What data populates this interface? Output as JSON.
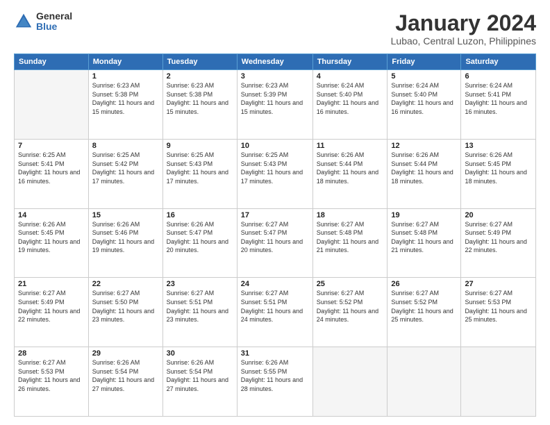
{
  "header": {
    "logo_general": "General",
    "logo_blue": "Blue",
    "month_title": "January 2024",
    "location": "Lubao, Central Luzon, Philippines"
  },
  "days_of_week": [
    "Sunday",
    "Monday",
    "Tuesday",
    "Wednesday",
    "Thursday",
    "Friday",
    "Saturday"
  ],
  "weeks": [
    [
      {
        "day": "",
        "sunrise": "",
        "sunset": "",
        "daylight": ""
      },
      {
        "day": "1",
        "sunrise": "Sunrise: 6:23 AM",
        "sunset": "Sunset: 5:38 PM",
        "daylight": "Daylight: 11 hours and 15 minutes."
      },
      {
        "day": "2",
        "sunrise": "Sunrise: 6:23 AM",
        "sunset": "Sunset: 5:38 PM",
        "daylight": "Daylight: 11 hours and 15 minutes."
      },
      {
        "day": "3",
        "sunrise": "Sunrise: 6:23 AM",
        "sunset": "Sunset: 5:39 PM",
        "daylight": "Daylight: 11 hours and 15 minutes."
      },
      {
        "day": "4",
        "sunrise": "Sunrise: 6:24 AM",
        "sunset": "Sunset: 5:40 PM",
        "daylight": "Daylight: 11 hours and 16 minutes."
      },
      {
        "day": "5",
        "sunrise": "Sunrise: 6:24 AM",
        "sunset": "Sunset: 5:40 PM",
        "daylight": "Daylight: 11 hours and 16 minutes."
      },
      {
        "day": "6",
        "sunrise": "Sunrise: 6:24 AM",
        "sunset": "Sunset: 5:41 PM",
        "daylight": "Daylight: 11 hours and 16 minutes."
      }
    ],
    [
      {
        "day": "7",
        "sunrise": "Sunrise: 6:25 AM",
        "sunset": "Sunset: 5:41 PM",
        "daylight": "Daylight: 11 hours and 16 minutes."
      },
      {
        "day": "8",
        "sunrise": "Sunrise: 6:25 AM",
        "sunset": "Sunset: 5:42 PM",
        "daylight": "Daylight: 11 hours and 17 minutes."
      },
      {
        "day": "9",
        "sunrise": "Sunrise: 6:25 AM",
        "sunset": "Sunset: 5:43 PM",
        "daylight": "Daylight: 11 hours and 17 minutes."
      },
      {
        "day": "10",
        "sunrise": "Sunrise: 6:25 AM",
        "sunset": "Sunset: 5:43 PM",
        "daylight": "Daylight: 11 hours and 17 minutes."
      },
      {
        "day": "11",
        "sunrise": "Sunrise: 6:26 AM",
        "sunset": "Sunset: 5:44 PM",
        "daylight": "Daylight: 11 hours and 18 minutes."
      },
      {
        "day": "12",
        "sunrise": "Sunrise: 6:26 AM",
        "sunset": "Sunset: 5:44 PM",
        "daylight": "Daylight: 11 hours and 18 minutes."
      },
      {
        "day": "13",
        "sunrise": "Sunrise: 6:26 AM",
        "sunset": "Sunset: 5:45 PM",
        "daylight": "Daylight: 11 hours and 18 minutes."
      }
    ],
    [
      {
        "day": "14",
        "sunrise": "Sunrise: 6:26 AM",
        "sunset": "Sunset: 5:45 PM",
        "daylight": "Daylight: 11 hours and 19 minutes."
      },
      {
        "day": "15",
        "sunrise": "Sunrise: 6:26 AM",
        "sunset": "Sunset: 5:46 PM",
        "daylight": "Daylight: 11 hours and 19 minutes."
      },
      {
        "day": "16",
        "sunrise": "Sunrise: 6:26 AM",
        "sunset": "Sunset: 5:47 PM",
        "daylight": "Daylight: 11 hours and 20 minutes."
      },
      {
        "day": "17",
        "sunrise": "Sunrise: 6:27 AM",
        "sunset": "Sunset: 5:47 PM",
        "daylight": "Daylight: 11 hours and 20 minutes."
      },
      {
        "day": "18",
        "sunrise": "Sunrise: 6:27 AM",
        "sunset": "Sunset: 5:48 PM",
        "daylight": "Daylight: 11 hours and 21 minutes."
      },
      {
        "day": "19",
        "sunrise": "Sunrise: 6:27 AM",
        "sunset": "Sunset: 5:48 PM",
        "daylight": "Daylight: 11 hours and 21 minutes."
      },
      {
        "day": "20",
        "sunrise": "Sunrise: 6:27 AM",
        "sunset": "Sunset: 5:49 PM",
        "daylight": "Daylight: 11 hours and 22 minutes."
      }
    ],
    [
      {
        "day": "21",
        "sunrise": "Sunrise: 6:27 AM",
        "sunset": "Sunset: 5:49 PM",
        "daylight": "Daylight: 11 hours and 22 minutes."
      },
      {
        "day": "22",
        "sunrise": "Sunrise: 6:27 AM",
        "sunset": "Sunset: 5:50 PM",
        "daylight": "Daylight: 11 hours and 23 minutes."
      },
      {
        "day": "23",
        "sunrise": "Sunrise: 6:27 AM",
        "sunset": "Sunset: 5:51 PM",
        "daylight": "Daylight: 11 hours and 23 minutes."
      },
      {
        "day": "24",
        "sunrise": "Sunrise: 6:27 AM",
        "sunset": "Sunset: 5:51 PM",
        "daylight": "Daylight: 11 hours and 24 minutes."
      },
      {
        "day": "25",
        "sunrise": "Sunrise: 6:27 AM",
        "sunset": "Sunset: 5:52 PM",
        "daylight": "Daylight: 11 hours and 24 minutes."
      },
      {
        "day": "26",
        "sunrise": "Sunrise: 6:27 AM",
        "sunset": "Sunset: 5:52 PM",
        "daylight": "Daylight: 11 hours and 25 minutes."
      },
      {
        "day": "27",
        "sunrise": "Sunrise: 6:27 AM",
        "sunset": "Sunset: 5:53 PM",
        "daylight": "Daylight: 11 hours and 25 minutes."
      }
    ],
    [
      {
        "day": "28",
        "sunrise": "Sunrise: 6:27 AM",
        "sunset": "Sunset: 5:53 PM",
        "daylight": "Daylight: 11 hours and 26 minutes."
      },
      {
        "day": "29",
        "sunrise": "Sunrise: 6:26 AM",
        "sunset": "Sunset: 5:54 PM",
        "daylight": "Daylight: 11 hours and 27 minutes."
      },
      {
        "day": "30",
        "sunrise": "Sunrise: 6:26 AM",
        "sunset": "Sunset: 5:54 PM",
        "daylight": "Daylight: 11 hours and 27 minutes."
      },
      {
        "day": "31",
        "sunrise": "Sunrise: 6:26 AM",
        "sunset": "Sunset: 5:55 PM",
        "daylight": "Daylight: 11 hours and 28 minutes."
      },
      {
        "day": "",
        "sunrise": "",
        "sunset": "",
        "daylight": ""
      },
      {
        "day": "",
        "sunrise": "",
        "sunset": "",
        "daylight": ""
      },
      {
        "day": "",
        "sunrise": "",
        "sunset": "",
        "daylight": ""
      }
    ]
  ]
}
